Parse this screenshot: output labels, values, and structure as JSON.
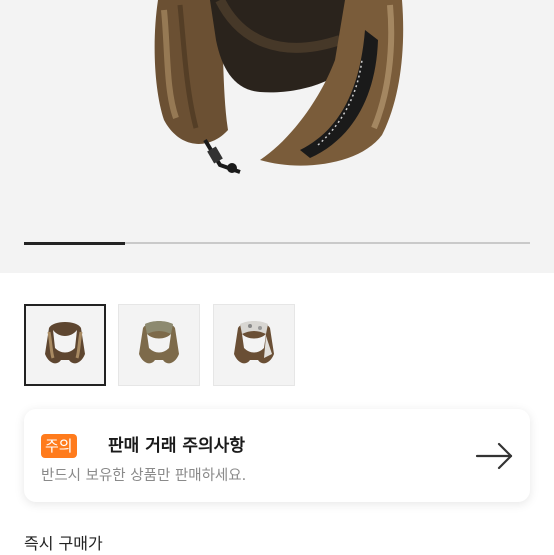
{
  "hero": {
    "image": "trapper-hat-photo",
    "slide_progress": 0.2
  },
  "thumbnails": [
    {
      "name": "trapper-hat-brown-fur",
      "selected": true
    },
    {
      "name": "trapper-hat-olive",
      "selected": false
    },
    {
      "name": "trapper-hat-white-camo",
      "selected": false
    }
  ],
  "notice": {
    "badge": "주의",
    "title": "판매 거래 주의사항",
    "description": "반드시 보유한 상품만 판매하세요.",
    "action_icon": "arrow-right-icon"
  },
  "section": {
    "label": "즉시 구매가"
  },
  "colors": {
    "badge": "#ff7b1c",
    "hero_bg": "#f3f3f3",
    "progress": "#222222"
  }
}
